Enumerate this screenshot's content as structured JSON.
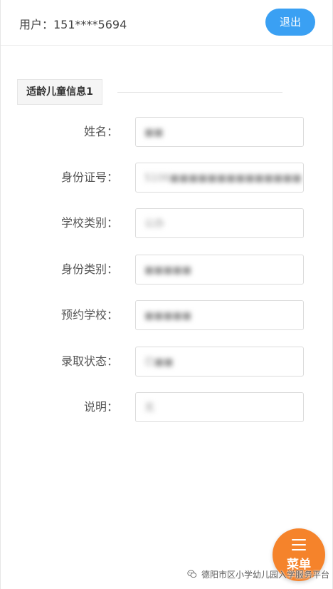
{
  "header": {
    "user_label": "用户：151****5694",
    "logout_label": "退出"
  },
  "section": {
    "tab_label": "适龄儿童信息1"
  },
  "form": {
    "fields": [
      {
        "label": "姓名：",
        "value": "■■"
      },
      {
        "label": "身份证号：",
        "value": "5106■■■■■■■■■■■■■■"
      },
      {
        "label": "学校类别：",
        "value": "公办"
      },
      {
        "label": "身份类别：",
        "value": "■■■■■"
      },
      {
        "label": "预约学校：",
        "value": "■■■■■"
      },
      {
        "label": "录取状态：",
        "value": "已■■"
      },
      {
        "label": "说明：",
        "value": "无"
      }
    ]
  },
  "menu": {
    "label": "菜单",
    "icon": "hamburger-icon",
    "color": "#f5832b"
  },
  "watermark": {
    "text": "德阳市区小学幼儿园入学服务平台",
    "icon": "wechat-icon"
  },
  "colors": {
    "primary": "#3aa0f3",
    "accent": "#f5832b"
  }
}
